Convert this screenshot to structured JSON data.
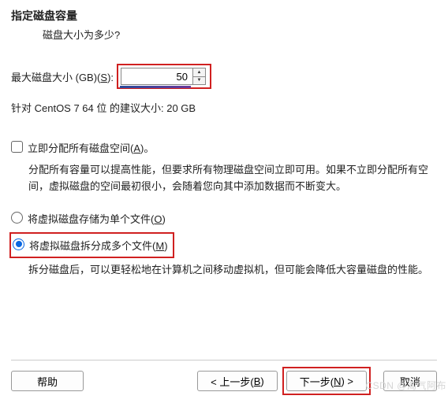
{
  "header": {
    "title": "指定磁盘容量",
    "subtitle": "磁盘大小为多少?"
  },
  "size": {
    "label_prefix": "最大磁盘大小 (GB)(",
    "label_key": "S",
    "label_suffix": "):",
    "value": "50"
  },
  "recommendation": "针对 CentOS 7 64 位 的建议大小: 20 GB",
  "allocate": {
    "prefix": "立即分配所有磁盘空间(",
    "key": "A",
    "suffix": ")。",
    "desc": "分配所有容量可以提高性能，但要求所有物理磁盘空间立即可用。如果不立即分配所有空间，虚拟磁盘的空间最初很小，会随着您向其中添加数据而不断变大。"
  },
  "single": {
    "prefix": "将虚拟磁盘存储为单个文件(",
    "key": "O",
    "suffix": ")"
  },
  "split": {
    "prefix": "将虚拟磁盘拆分成多个文件(",
    "key": "M",
    "suffix": ")",
    "desc": "拆分磁盘后，可以更轻松地在计算机之间移动虚拟机，但可能会降低大容量磁盘的性能。"
  },
  "buttons": {
    "help": "帮助",
    "back_prefix": "< 上一步(",
    "back_key": "B",
    "back_suffix": ")",
    "next_prefix": "下一步(",
    "next_key": "N",
    "next_suffix": ") >",
    "cancel": "取消"
  },
  "watermark": "CSDN @淘气阿布"
}
